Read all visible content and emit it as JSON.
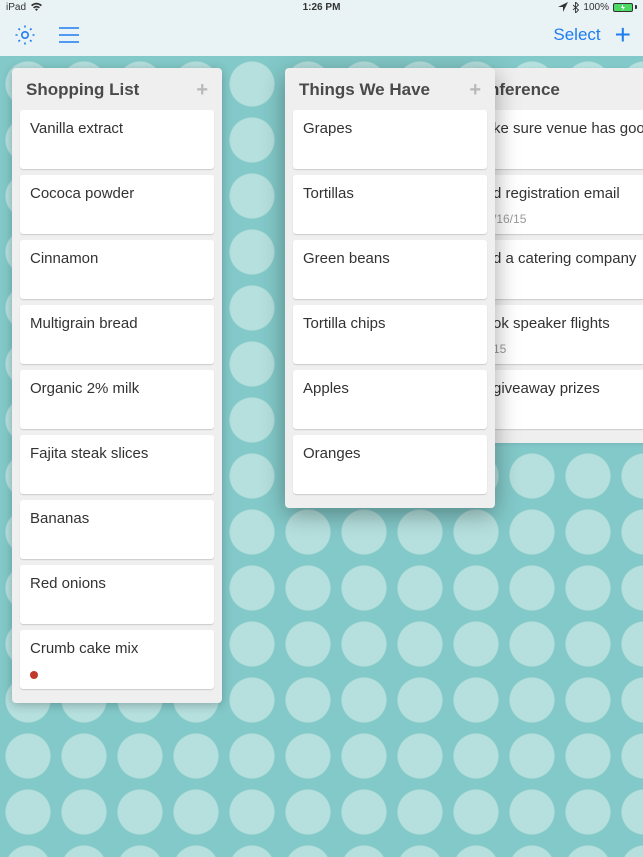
{
  "statusbar": {
    "device": "iPad",
    "time": "1:26 PM",
    "bt": "100%"
  },
  "toolbar": {
    "select_label": "Select"
  },
  "lists": {
    "shopping": {
      "title": "Shopping List",
      "cards": [
        "Vanilla extract",
        "Cococa powder",
        "Cinnamon",
        "Multigrain bread",
        "Organic 2% milk",
        "Fajita steak slices",
        "Bananas",
        "Red onions",
        "Crumb cake mix"
      ]
    },
    "have": {
      "title": "Things We Have",
      "cards": [
        "Grapes",
        "Tortillas",
        "Green beans",
        "Tortilla chips",
        "Apples",
        "Oranges"
      ]
    },
    "conference": {
      "title": "nference",
      "cards": [
        {
          "text": "ke sure venue has good i",
          "date": ""
        },
        {
          "text": "d registration email",
          "date": "/16/15"
        },
        {
          "text": "d a catering company",
          "date": ""
        },
        {
          "text": "ok speaker flights",
          "date": "15"
        },
        {
          "text": " giveaway prizes",
          "date": ""
        }
      ]
    }
  }
}
